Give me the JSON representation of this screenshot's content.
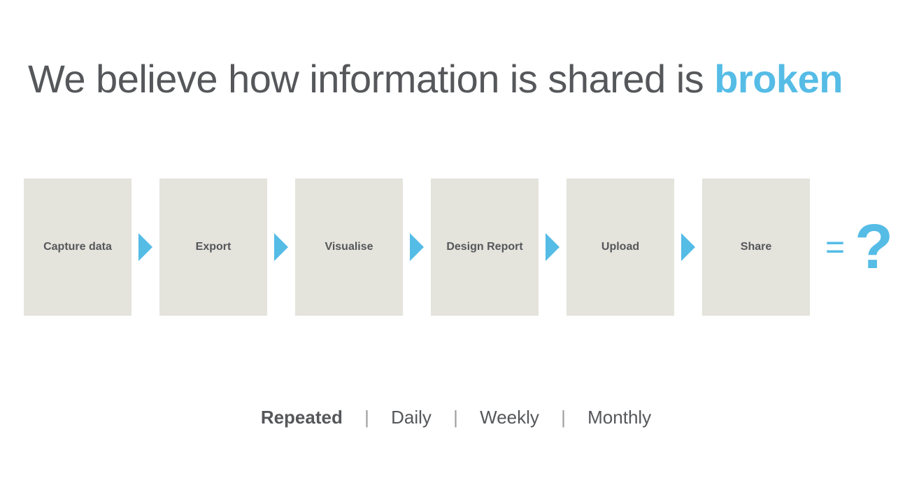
{
  "headline": {
    "prefix": "We believe how information is shared is ",
    "emphasis": "broken"
  },
  "steps": [
    "Capture data",
    "Export",
    "Visualise",
    "Design Report",
    "Upload",
    "Share"
  ],
  "result": {
    "equals": "=",
    "question": "?"
  },
  "frequency": {
    "lead": "Repeated",
    "items": [
      "Daily",
      "Weekly",
      "Monthly"
    ],
    "separator": "|"
  },
  "colors": {
    "accent": "#55bce6",
    "text": "#55575a",
    "box": "#e4e3dc"
  }
}
